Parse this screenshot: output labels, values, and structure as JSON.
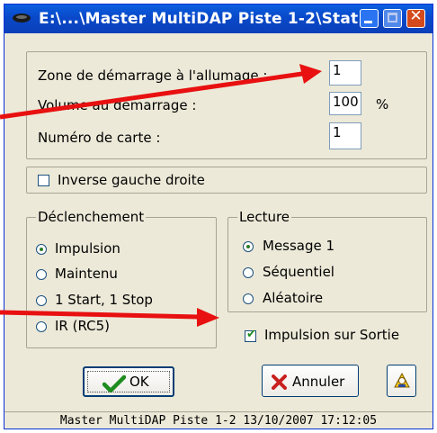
{
  "window": {
    "title": "E:\\...\\Master MultiDAP Piste 1-2\\Stat...",
    "status": "Master MultiDAP Piste 1-2 13/10/2007 17:12:05"
  },
  "settings": {
    "zone_label": "Zone de démarrage à l'allumage :",
    "zone_value": "1",
    "volume_label": "Volume au démarrage :",
    "volume_value": "100",
    "volume_unit": "%",
    "card_label": "Numéro de carte :",
    "card_value": "1"
  },
  "invert": {
    "label": "Inverse gauche droite",
    "checked": false
  },
  "declenchement": {
    "legend": "Déclenchement",
    "options": [
      "Impulsion",
      "Maintenu",
      "1 Start, 1 Stop",
      "IR (RC5)"
    ],
    "selected": 0
  },
  "lecture": {
    "legend": "Lecture",
    "options": [
      "Message 1",
      "Séquentiel",
      "Aléatoire"
    ],
    "selected": 0
  },
  "output_pulse": {
    "label": "Impulsion sur Sortie",
    "checked": true
  },
  "buttons": {
    "ok": "OK",
    "cancel": "Annuler"
  },
  "colors": {
    "title_blue": "#0a5fe0",
    "face": "#ece9d8",
    "arrow_red": "#e81010"
  }
}
